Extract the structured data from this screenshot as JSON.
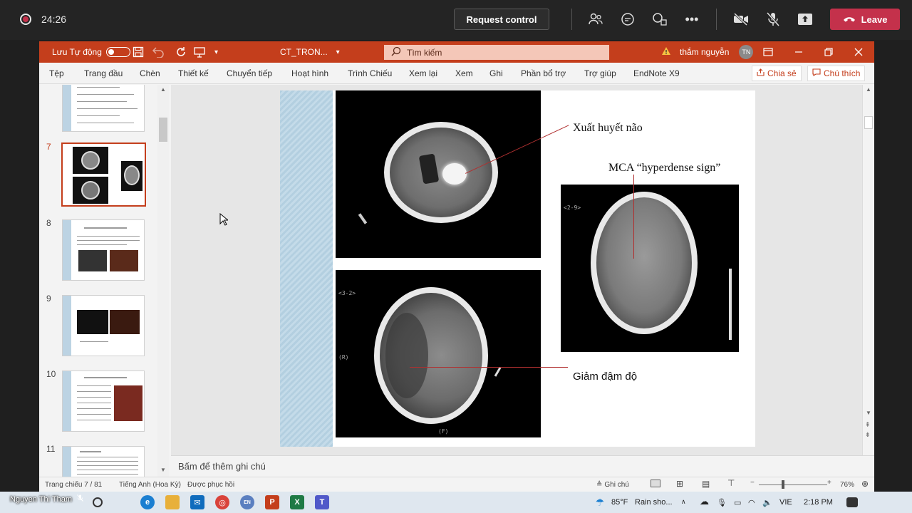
{
  "teams": {
    "timer": "24:26",
    "request_control": "Request control",
    "leave": "Leave",
    "presenter_name": "Nguyen Thi Tham"
  },
  "ppt": {
    "autosave_label": "Lưu Tự động",
    "file_name": "CT_TRON...",
    "search_placeholder": "Tìm kiếm",
    "user_name": "thắm nguyễn",
    "user_initials": "TN",
    "menu": [
      "Tệp",
      "Trang đầu",
      "Chèn",
      "Thiết kế",
      "Chuyển tiếp",
      "Hoạt hình",
      "Trình Chiếu",
      "Xem lại",
      "Xem",
      "Ghi",
      "Phần bổ trợ",
      "Trợ giúp",
      "EndNote X9"
    ],
    "share": "Chia sẻ",
    "comments": "Chú thích",
    "thumbnails": [
      {
        "number": "7"
      },
      {
        "number": "8"
      },
      {
        "number": "9"
      },
      {
        "number": "10"
      },
      {
        "number": "11"
      }
    ],
    "slide": {
      "caption_hemorrhage": "Xuất huyết não",
      "caption_mca": "MCA “hyperdense sign”",
      "caption_hypodense": "Giảm đậm độ",
      "ct_label_1": "<2-9>",
      "ct_label_2": "<3-2>",
      "ct_label_3": "(R)",
      "ct_label_4": "(R)",
      "ct_label_5": "(F)"
    },
    "notes_placeholder": "Bấm để thêm ghi chú",
    "status": {
      "slide_counter": "Trang chiếu 7 / 81",
      "language": "Tiếng Anh (Hoa Kỳ)",
      "recovered": "Được phục hồi",
      "notes_btn": "Ghi chú",
      "zoom": "76%"
    }
  },
  "taskbar": {
    "weather": "85°F",
    "weather_desc": "Rain sho...",
    "lang": "VIE",
    "time": "2:18 PM"
  },
  "colors": {
    "ppt_accent": "#c43e1c",
    "leave": "#c4314b"
  }
}
